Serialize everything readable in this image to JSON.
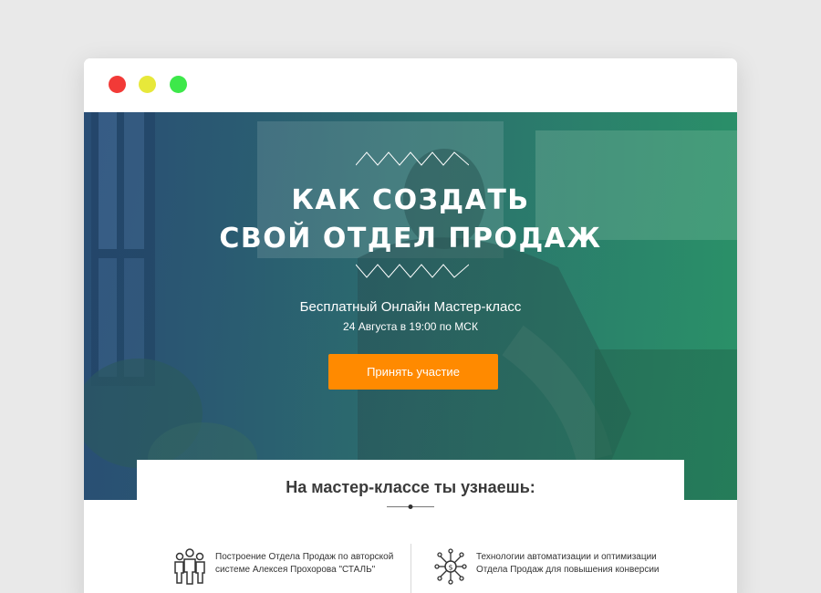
{
  "window": {
    "controls": {
      "close_color": "#f23a37",
      "minimize_color": "#e7e83a",
      "maximize_color": "#3de84a"
    }
  },
  "hero": {
    "title_line1": "Как создать",
    "title_line2": "свой отдел продаж",
    "subtitle": "Бесплатный Онлайн Мастер-класс",
    "date": "24 Августа в 19:00 по МСК",
    "cta_label": "Принять участие",
    "cta_color": "#ff8a00",
    "gradient_colors": [
      "#3c6286",
      "#2e9e6a"
    ]
  },
  "learn_section": {
    "title": "На мастер-классе ты узнаешь:",
    "features": [
      {
        "icon": "team-icon",
        "text": "Построение Отдела Продаж по авторской системе Алексея Прохорова \"СТАЛЬ\""
      },
      {
        "icon": "network-dollar-icon",
        "text": "Технологии автоматизации и оптимизации Отдела Продаж для повышения конверсии"
      }
    ]
  }
}
